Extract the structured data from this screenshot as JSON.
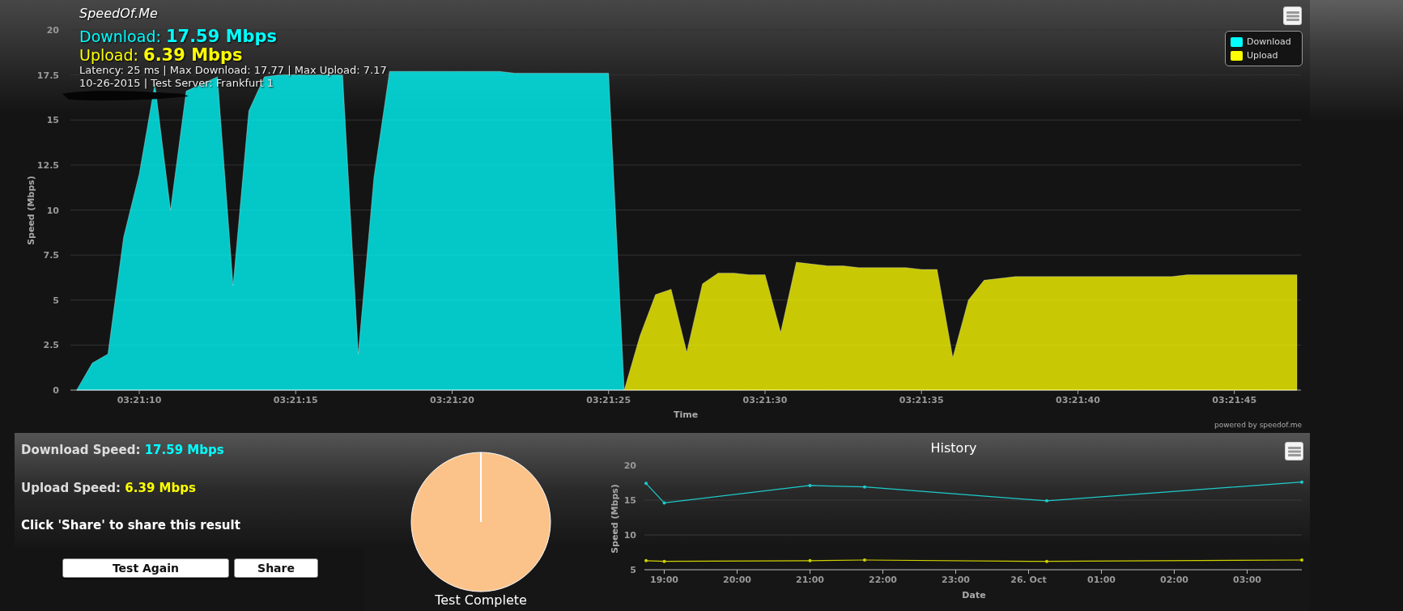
{
  "main_chart": {
    "title": "SpeedOf.Me",
    "headline": [
      {
        "kind": "download",
        "label": "Download:",
        "value": "17.59 Mbps",
        "color": "#00ffff"
      },
      {
        "kind": "upload",
        "label": "Upload:",
        "value": "6.39 Mbps",
        "color": "#ffff00"
      }
    ],
    "details": [
      "Latency: 25 ms | Max Download: 17.77 | Max Upload: 7.17",
      "10-26-2015 | Test Server: Frankfurt 1"
    ],
    "credit": "powered by speedof.me",
    "chart_data": {
      "type": "area",
      "xlabel": "Time",
      "ylabel": "Speed (Mbps)",
      "categories": [
        null,
        null,
        null,
        null,
        "03:21:10",
        null,
        null,
        null,
        null,
        null,
        null,
        null,
        null,
        null,
        "03:21:15",
        null,
        null,
        null,
        null,
        null,
        null,
        null,
        null,
        null,
        "03:21:20",
        null,
        null,
        null,
        null,
        null,
        null,
        null,
        null,
        null,
        "03:21:25",
        null,
        null,
        null,
        null,
        null,
        null,
        null,
        null,
        null,
        "03:21:30",
        null,
        null,
        null,
        null,
        null,
        null,
        null,
        null,
        null,
        "03:21:35",
        null,
        null,
        null,
        null,
        null,
        null,
        null,
        null,
        null,
        "03:21:40",
        null,
        null,
        null,
        null,
        null,
        null,
        null,
        null,
        null,
        "03:21:45",
        null,
        null,
        null,
        null
      ],
      "series": [
        {
          "name": "Download",
          "color": "#00ffff",
          "values": [
            0,
            1.5,
            2,
            8.5,
            12,
            17,
            10,
            16.6,
            17,
            17.4,
            5.8,
            15.5,
            17.4,
            17.5,
            17.5,
            17.5,
            17.5,
            17.5,
            2,
            11.8,
            17.7,
            17.7,
            17.7,
            17.7,
            17.7,
            17.7,
            17.7,
            17.7,
            17.6,
            17.6,
            17.6,
            17.6,
            17.6,
            17.6,
            17.6,
            0,
            0,
            0,
            0,
            0,
            0,
            0,
            0,
            0,
            0,
            0,
            0,
            0,
            0,
            0,
            0,
            0,
            0,
            0,
            0,
            0,
            0,
            0,
            0,
            0,
            0,
            0,
            0,
            0,
            0,
            0,
            0,
            0,
            0,
            0,
            0,
            0,
            0,
            0,
            0,
            0,
            0,
            0,
            0
          ]
        },
        {
          "name": "Upload",
          "color": "#ffff00",
          "values": [
            0,
            0,
            0,
            0,
            0,
            0,
            0,
            0,
            0,
            0,
            0,
            0,
            0,
            0,
            0,
            0,
            0,
            0,
            0,
            0,
            0,
            0,
            0,
            0,
            0,
            0,
            0,
            0,
            0,
            0,
            0,
            0,
            0,
            0,
            0,
            0,
            3,
            5.3,
            5.6,
            2.1,
            5.9,
            6.5,
            6.5,
            6.4,
            6.4,
            3.2,
            7.1,
            7.0,
            6.9,
            6.9,
            6.8,
            6.8,
            6.8,
            6.8,
            6.7,
            6.7,
            1.8,
            5.0,
            6.1,
            6.2,
            6.3,
            6.3,
            6.3,
            6.3,
            6.3,
            6.3,
            6.3,
            6.3,
            6.3,
            6.3,
            6.3,
            6.4,
            6.4,
            6.4,
            6.4,
            6.4,
            6.4,
            6.4,
            6.4
          ]
        }
      ],
      "ylim": [
        0,
        20
      ],
      "grid": true,
      "yticks": [
        0,
        2.5,
        5,
        7.5,
        10,
        12.5,
        15,
        17.5,
        20
      ]
    }
  },
  "summary": {
    "rows": [
      {
        "label": "Download Speed:",
        "value": "17.59 Mbps",
        "color": "#00ffff"
      },
      {
        "label": "Upload Speed:",
        "value": "6.39 Mbps",
        "color": "#ffff00"
      }
    ],
    "note": "Click 'Share' to share this result",
    "buttons": [
      "Test Again",
      "Share"
    ]
  },
  "progress": {
    "level": 1,
    "label": "Test Complete"
  },
  "history": {
    "title": "History",
    "chart_data": {
      "type": "line",
      "xlabel": "Date",
      "ylabel": "Speed (Mbps)",
      "categories": [
        null,
        "19:00",
        null,
        null,
        null,
        "20:00",
        null,
        null,
        null,
        "21:00",
        null,
        null,
        null,
        "22:00",
        null,
        null,
        null,
        "23:00",
        null,
        null,
        null,
        "26. Oct",
        null,
        null,
        null,
        "01:00",
        null,
        null,
        null,
        "02:00",
        null,
        null,
        null,
        "03:00",
        null,
        null,
        null
      ],
      "series": [
        {
          "color": "#1ecbcb",
          "values": [
            17.4,
            14.6,
            null,
            null,
            null,
            null,
            null,
            null,
            null,
            17.1,
            null,
            null,
            16.9,
            null,
            null,
            null,
            null,
            null,
            null,
            null,
            null,
            null,
            14.9,
            null,
            null,
            null,
            null,
            null,
            null,
            null,
            null,
            null,
            null,
            null,
            null,
            null,
            17.6
          ]
        },
        {
          "color": "#d2d200",
          "values": [
            6.3,
            6.2,
            null,
            null,
            null,
            null,
            null,
            null,
            null,
            6.3,
            null,
            null,
            6.4,
            null,
            null,
            null,
            null,
            null,
            null,
            null,
            null,
            null,
            6.2,
            null,
            null,
            null,
            null,
            null,
            null,
            null,
            null,
            null,
            null,
            null,
            null,
            null,
            6.4
          ]
        }
      ],
      "ylim": [
        5,
        20
      ],
      "grid": true,
      "yticks": [
        5,
        10,
        15,
        20
      ]
    }
  }
}
